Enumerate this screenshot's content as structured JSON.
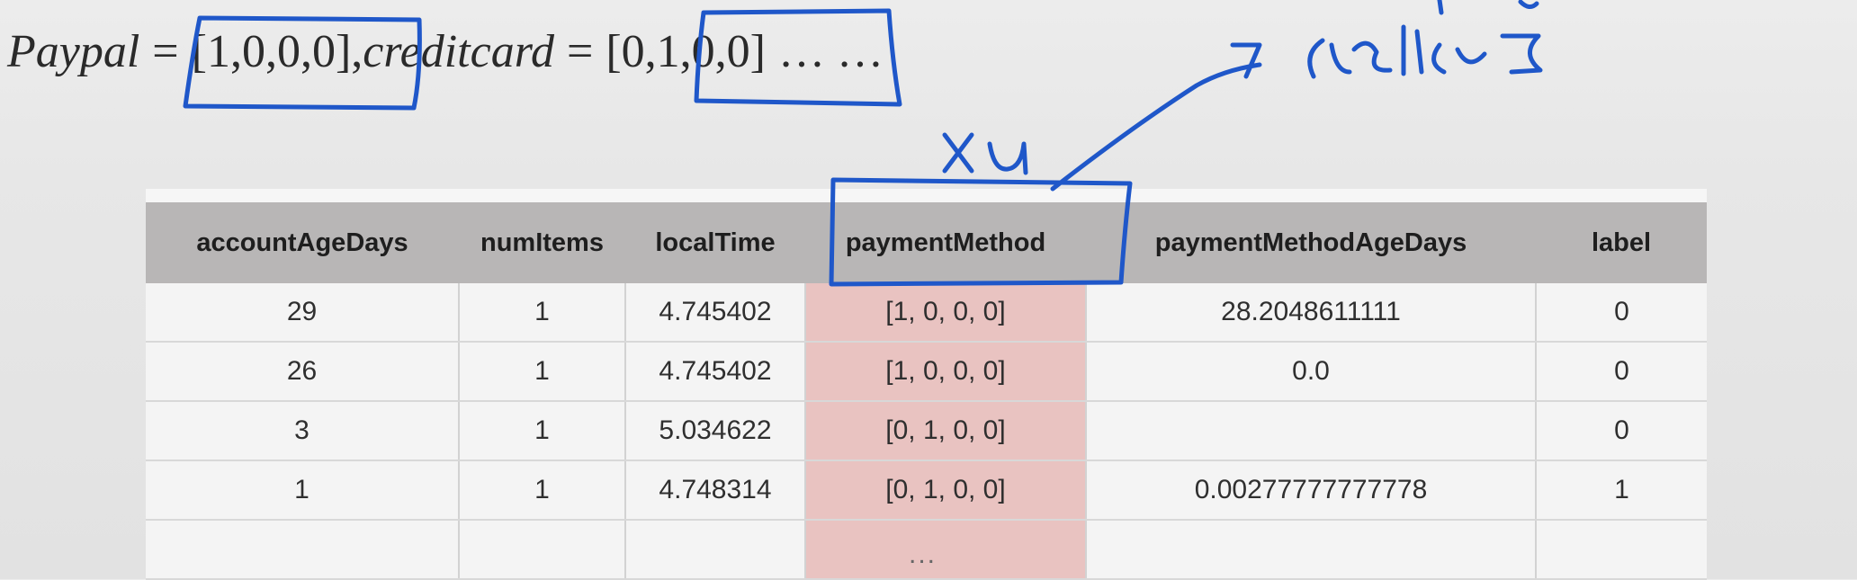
{
  "formula": {
    "var1": "Paypal",
    "eq1": "=",
    "vec1": "[1,0,0,0]",
    "comma": ",",
    "var2": "creditcard",
    "eq2": "=",
    "vec2": "[0,1,0,0]",
    "dots": "… …"
  },
  "annotations": {
    "top_right_note": "creditcard",
    "column_note": "xu",
    "ink_color": "#1f57c9"
  },
  "table": {
    "columns": [
      "accountAgeDays",
      "numItems",
      "localTime",
      "paymentMethod",
      "paymentMethodAgeDays",
      "label"
    ],
    "rows": [
      [
        "29",
        "1",
        "4.745402",
        "[1, 0, 0, 0]",
        "28.2048611111",
        "0"
      ],
      [
        "26",
        "1",
        "4.745402",
        "[1, 0, 0, 0]",
        "0.0",
        "0"
      ],
      [
        "3",
        "1",
        "5.034622",
        "[0, 1, 0, 0]",
        "",
        "0"
      ],
      [
        "1",
        "1",
        "4.748314",
        "[0, 1, 0, 0]",
        "0.00277777777778",
        "1"
      ]
    ],
    "more": "..."
  },
  "colors": {
    "header_bg": "#b8b6b6",
    "highlight_column": "#e9c3c1",
    "page_bg": "#e7e7e7"
  }
}
